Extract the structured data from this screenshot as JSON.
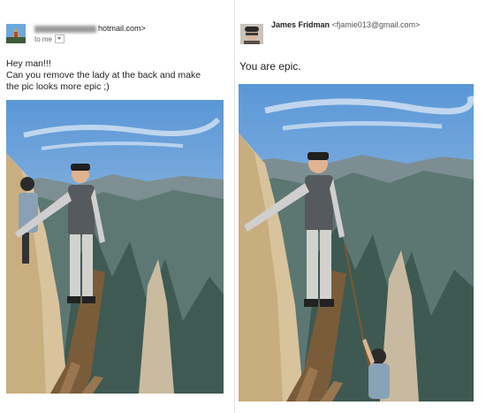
{
  "original": {
    "from": "hotmail.com>",
    "to_label": "to me",
    "message_lines": [
      "Hey man!!!",
      "Can you remove the lady at the back and make",
      "the pic looks more epic ;)"
    ]
  },
  "reply": {
    "sender_name": "James Fridman",
    "sender_email": "<fjamie013@gmail.com>",
    "message": "You are epic."
  },
  "colors": {
    "sky_top": "#5b97d6",
    "sky_bottom": "#b9d3ea",
    "mountain": "#4f6b66",
    "rock": "#d9c49d",
    "plank": "#8a6a45"
  }
}
